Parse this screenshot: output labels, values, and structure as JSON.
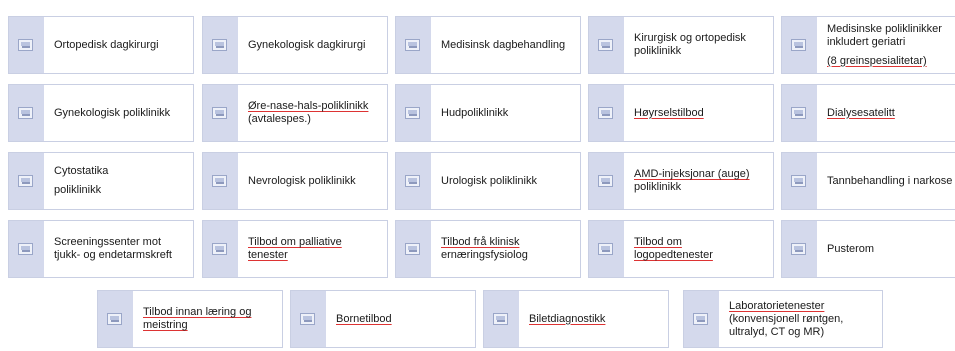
{
  "services": [
    {
      "lines": [
        "Ortopedisk dagkirurgi"
      ]
    },
    {
      "lines": [
        "Gynekologisk dagkirurgi"
      ]
    },
    {
      "lines": [
        "Medisinsk dagbehandling"
      ]
    },
    {
      "lines": [
        "Kirurgisk og ortopedisk",
        "poliklinikk"
      ]
    },
    {
      "lines": [
        "Medisinske poliklinikker",
        "inkludert geriatri",
        "(8 greinspesialitetar)"
      ]
    },
    {
      "lines": [
        "Gynekologisk poliklinikk"
      ]
    },
    {
      "lines": [
        "Øre-nase-hals-poliklinikk",
        "(avtalespes.)"
      ]
    },
    {
      "lines": [
        "Hudpoliklinikk"
      ]
    },
    {
      "lines": [
        "Høyrselstilbod"
      ]
    },
    {
      "lines": [
        "Dialysesatelitt"
      ]
    },
    {
      "lines": [
        "Cytostatika",
        "poliklinikk"
      ]
    },
    {
      "lines": [
        "Nevrologisk poliklinikk"
      ]
    },
    {
      "lines": [
        "Urologisk poliklinikk"
      ]
    },
    {
      "lines": [
        "AMD-injeksjonar (auge)",
        "poliklinikk"
      ]
    },
    {
      "lines": [
        "Tannbehandling i narkose"
      ]
    },
    {
      "lines": [
        "Screeningssenter mot",
        "tjukk- og endetarmskreft"
      ]
    },
    {
      "lines": [
        "Tilbod om palliative",
        "tenester"
      ]
    },
    {
      "lines": [
        "Tilbod frå klinisk",
        "ernæringsfysiolog"
      ]
    },
    {
      "lines": [
        "Tilbod om",
        "logopedtenester"
      ]
    },
    {
      "lines": [
        "Pusterom"
      ]
    },
    {
      "lines": [
        "Tilbod innan læring og",
        "meistring"
      ]
    },
    {
      "lines": [
        "Bornetilbod"
      ]
    },
    {
      "lines": [
        "Biletdiagnostikk"
      ]
    },
    {
      "lines": [
        "Laboratorietenester",
        "(konvensjonell røntgen,",
        "ultralyd, CT og MR)"
      ]
    }
  ]
}
